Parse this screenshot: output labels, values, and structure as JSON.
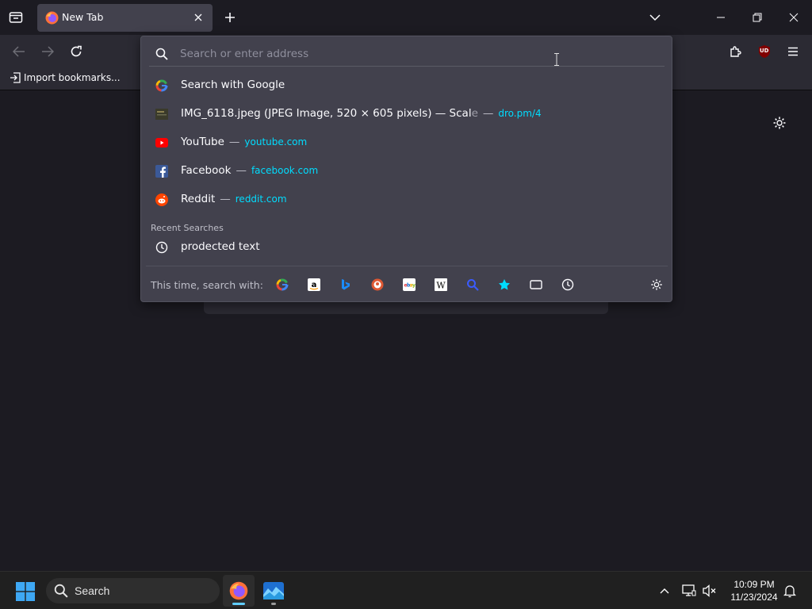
{
  "browser": {
    "tab": {
      "title": "New Tab"
    },
    "bookmarks_bar": {
      "import_label": "Import bookmarks..."
    },
    "extension_badge": "UD"
  },
  "urlbar": {
    "placeholder": "Search or enter address",
    "results": [
      {
        "icon": "google-icon",
        "title": "Search with Google",
        "url": ""
      },
      {
        "icon": "image-thumbnail-icon",
        "title": "IMG_6118.jpeg (JPEG Image, 520 × 605 pixels) — Scal",
        "title_fade": "e",
        "url": "dro.pm/4"
      },
      {
        "icon": "youtube-icon",
        "title": "YouTube",
        "url": "youtube.com"
      },
      {
        "icon": "facebook-icon",
        "title": "Facebook",
        "url": "facebook.com"
      },
      {
        "icon": "reddit-icon",
        "title": "Reddit",
        "url": "reddit.com"
      }
    ],
    "recent_label": "Recent Searches",
    "recent": [
      {
        "icon": "history-clock-icon",
        "title": "prodected text"
      }
    ],
    "separator": "—",
    "oneoff_label": "This time, search with:",
    "engines": [
      "google-icon",
      "amazon-icon",
      "bing-icon",
      "duckduckgo-icon",
      "ebay-icon",
      "wikipedia-icon",
      "search-shortcut-icon",
      "bookmarks-star-icon",
      "tabs-icon",
      "history-icon"
    ]
  },
  "taskbar": {
    "search_label": "Search",
    "time": "10:09 PM",
    "date": "11/23/2024"
  },
  "colors": {
    "accent": "#00ddff",
    "panel": "#42414d",
    "toolbar": "#2b2a33",
    "background": "#1c1b22"
  }
}
